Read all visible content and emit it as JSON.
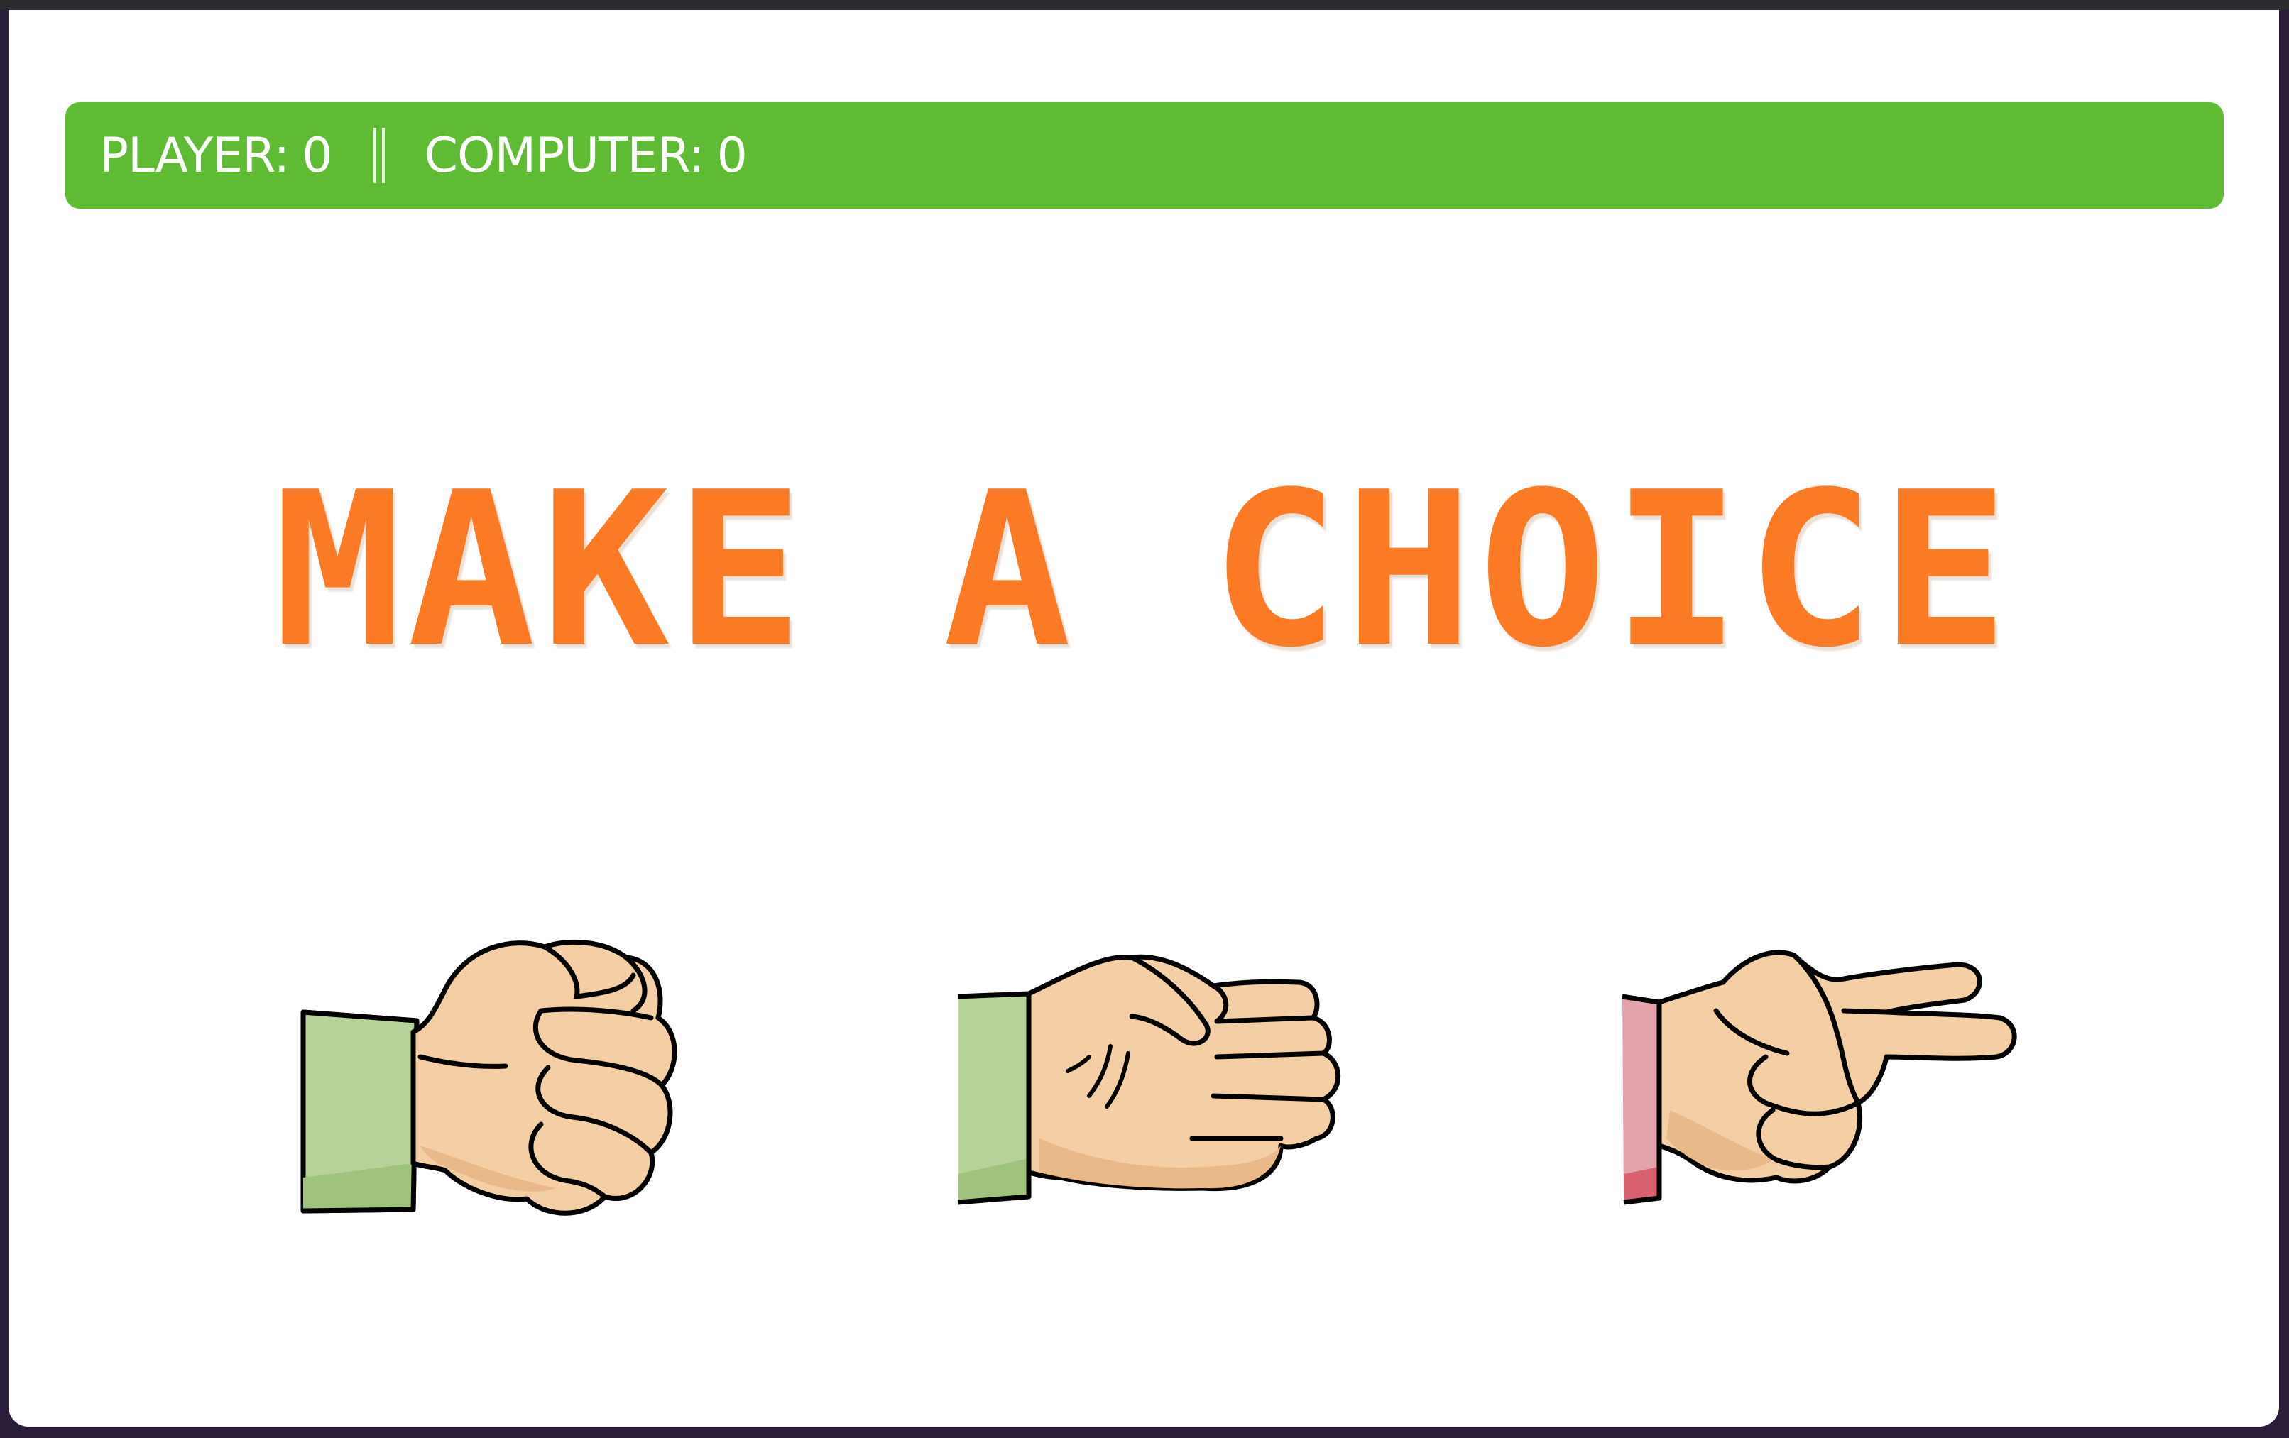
{
  "scoreboard": {
    "player_label": "PLAYER:",
    "player_score": "0",
    "computer_label": "COMPUTER:",
    "computer_score": "0"
  },
  "headline": "MAKE A CHOICE",
  "choices": [
    {
      "name": "rock",
      "icon": "rock-hand-icon"
    },
    {
      "name": "paper",
      "icon": "paper-hand-icon"
    },
    {
      "name": "scissors",
      "icon": "scissors-hand-icon"
    }
  ],
  "colors": {
    "scorebar": "#5fbb34",
    "headline": "#fb7a26",
    "skin": "#f4cfa5",
    "skin_shadow": "#eab98a",
    "sleeve_green": "#b8d399",
    "sleeve_green_shadow": "#9fc27d",
    "sleeve_pink": "#e2a3aa",
    "sleeve_pink_shadow": "#d8606f"
  }
}
